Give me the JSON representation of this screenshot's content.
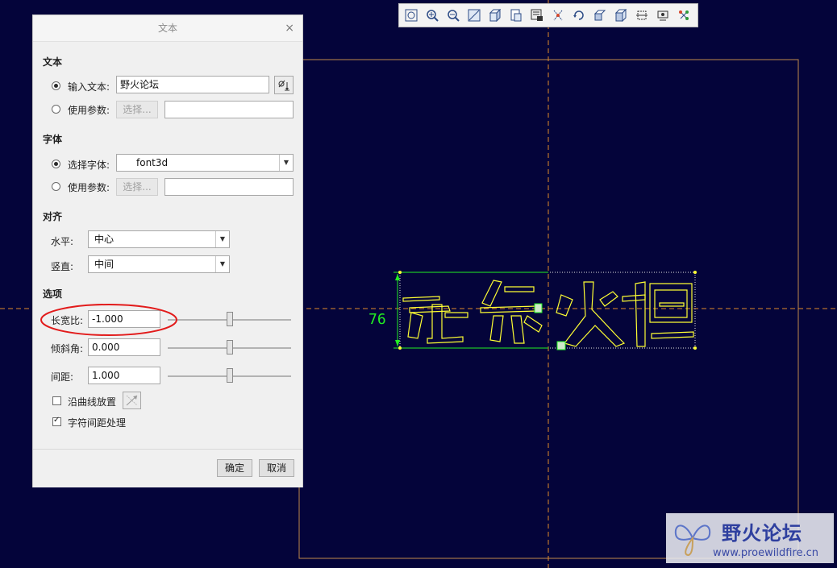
{
  "dialog": {
    "title": "文本",
    "close_glyph": "×",
    "sections": {
      "text": "文本",
      "font": "字体",
      "align": "对齐",
      "options": "选项"
    },
    "text_section": {
      "input_text_label": "输入文本:",
      "input_text_value": "野火论坛",
      "input_text_selected": true,
      "use_param_label": "使用参数:",
      "select_button": "选择...",
      "param_value": ""
    },
    "font_section": {
      "select_font_label": "选择字体:",
      "font_value": "font3d",
      "select_font_selected": true,
      "use_param_label": "使用参数:",
      "select_button": "选择...",
      "param_value": ""
    },
    "align_section": {
      "horizontal_label": "水平:",
      "horizontal_value": "中心",
      "vertical_label": "竖直:",
      "vertical_value": "中间"
    },
    "options_section": {
      "aspect_label": "长宽比:",
      "aspect_value": "-1.000",
      "aspect_slider": 0.5,
      "slant_label": "倾斜角:",
      "slant_value": "0.000",
      "slant_slider": 0.5,
      "spacing_label": "间距:",
      "spacing_value": "1.000",
      "spacing_slider": 0.5,
      "along_curve_label": "沿曲线放置",
      "along_curve_checked": false,
      "kerning_label": "字符间距处理",
      "kerning_checked": true
    },
    "ok_button": "确定",
    "cancel_button": "取消"
  },
  "sketch": {
    "dimension_label": "76",
    "highlight_color": "#e21b1b",
    "text_color": "#ffff33",
    "dimension_color": "#22ee22",
    "frame_color": "#c08a4a",
    "background": "#04043a"
  },
  "toolbar": {
    "icons": [
      "refit-icon",
      "zoom-in-icon",
      "zoom-out-icon",
      "repaint-icon",
      "display-style-icon",
      "saved-views-icon",
      "view-manager-icon",
      "datum-display-icon",
      "spin-center-icon",
      "annotation-display-icon",
      "orient-icon",
      "sketch-view-icon",
      "sketcher-display-icon",
      "constraint-display-icon"
    ]
  },
  "watermark": {
    "title": "野火论坛",
    "url": "www.proewildfire.cn"
  }
}
